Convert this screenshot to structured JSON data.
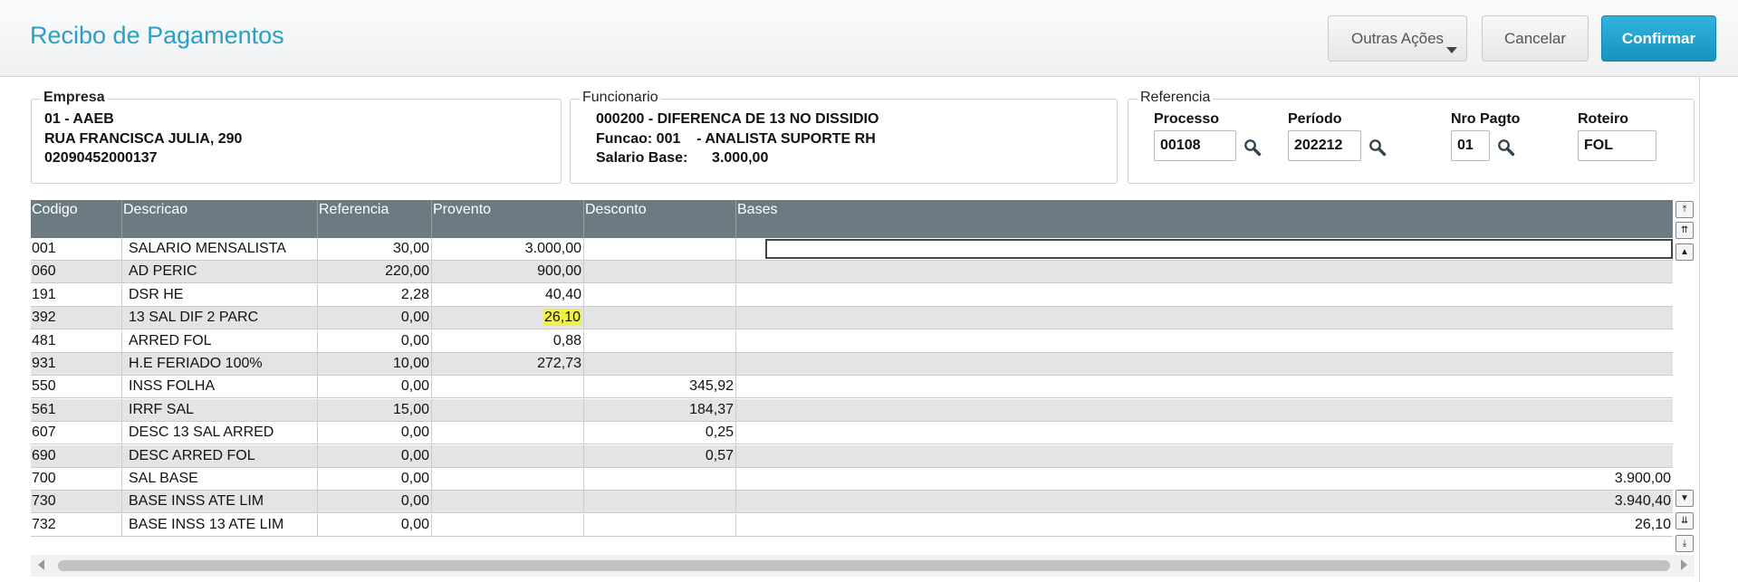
{
  "header": {
    "title": "Recibo de Pagamentos",
    "more_actions": "Outras Ações",
    "cancel": "Cancelar",
    "confirm": "Confirmar"
  },
  "empresa": {
    "legend": "Empresa",
    "line1": "01 - AAEB",
    "line2": "RUA FRANCISCA JULIA, 290",
    "line3": "02090452000137"
  },
  "funcionario": {
    "legend": "Funcionario",
    "line1": "000200 - DIFERENCA DE 13 NO DISSIDIO",
    "line2": "Funcao: 001    - ANALISTA SUPORTE RH",
    "line3": "Salario Base:      3.000,00"
  },
  "referencia": {
    "legend": "Referencia",
    "processo_label": "Processo",
    "processo_value": "00108",
    "periodo_label": "Período",
    "periodo_value": "202212",
    "nro_label": "Nro Pagto",
    "nro_value": "01",
    "roteiro_label": "Roteiro",
    "roteiro_value": "FOL"
  },
  "grid": {
    "columns": [
      "Codigo",
      "Descricao",
      "Referencia",
      "Provento",
      "Desconto",
      "Bases"
    ],
    "rows": [
      {
        "codigo": "001",
        "descricao": "SALARIO MENSALISTA",
        "referencia": "30,00",
        "provento": "3.000,00",
        "desconto": "",
        "bases": ""
      },
      {
        "codigo": "060",
        "descricao": "AD PERIC",
        "referencia": "220,00",
        "provento": "900,00",
        "desconto": "",
        "bases": ""
      },
      {
        "codigo": "191",
        "descricao": "DSR HE",
        "referencia": "2,28",
        "provento": "40,40",
        "desconto": "",
        "bases": ""
      },
      {
        "codigo": "392",
        "descricao": "13 SAL DIF 2 PARC",
        "referencia": "0,00",
        "provento": "26,10",
        "desconto": "",
        "bases": ""
      },
      {
        "codigo": "481",
        "descricao": "ARRED FOL",
        "referencia": "0,00",
        "provento": "0,88",
        "desconto": "",
        "bases": ""
      },
      {
        "codigo": "931",
        "descricao": "H.E FERIADO 100%",
        "referencia": "10,00",
        "provento": "272,73",
        "desconto": "",
        "bases": ""
      },
      {
        "codigo": "550",
        "descricao": "INSS FOLHA",
        "referencia": "0,00",
        "provento": "",
        "desconto": "345,92",
        "bases": ""
      },
      {
        "codigo": "561",
        "descricao": "IRRF SAL",
        "referencia": "15,00",
        "provento": "",
        "desconto": "184,37",
        "bases": ""
      },
      {
        "codigo": "607",
        "descricao": "DESC 13 SAL ARRED",
        "referencia": "0,00",
        "provento": "",
        "desconto": "0,25",
        "bases": ""
      },
      {
        "codigo": "690",
        "descricao": "DESC ARRED FOL",
        "referencia": "0,00",
        "provento": "",
        "desconto": "0,57",
        "bases": ""
      },
      {
        "codigo": "700",
        "descricao": "SAL BASE",
        "referencia": "0,00",
        "provento": "",
        "desconto": "",
        "bases": "3.900,00"
      },
      {
        "codigo": "730",
        "descricao": "BASE INSS ATE LIM",
        "referencia": "0,00",
        "provento": "",
        "desconto": "",
        "bases": "3.940,40"
      },
      {
        "codigo": "732",
        "descricao": "BASE INSS 13 ATE LIM",
        "referencia": "0,00",
        "provento": "",
        "desconto": "",
        "bases": "26,10"
      }
    ]
  },
  "icons": {
    "lookup": "magnifier-icon",
    "scroll_top": "double-up-arrow-icon",
    "scroll_page_up": "double-up-icon",
    "scroll_up": "up-arrow-icon",
    "scroll_down": "down-arrow-icon",
    "scroll_page_down": "double-down-icon",
    "scroll_bottom": "double-down-arrow-icon"
  },
  "colors": {
    "title": "#2b9fc4",
    "confirm_button": "#1a93c0",
    "grid_header": "#6c7b82",
    "highlight": "#f2f044"
  }
}
